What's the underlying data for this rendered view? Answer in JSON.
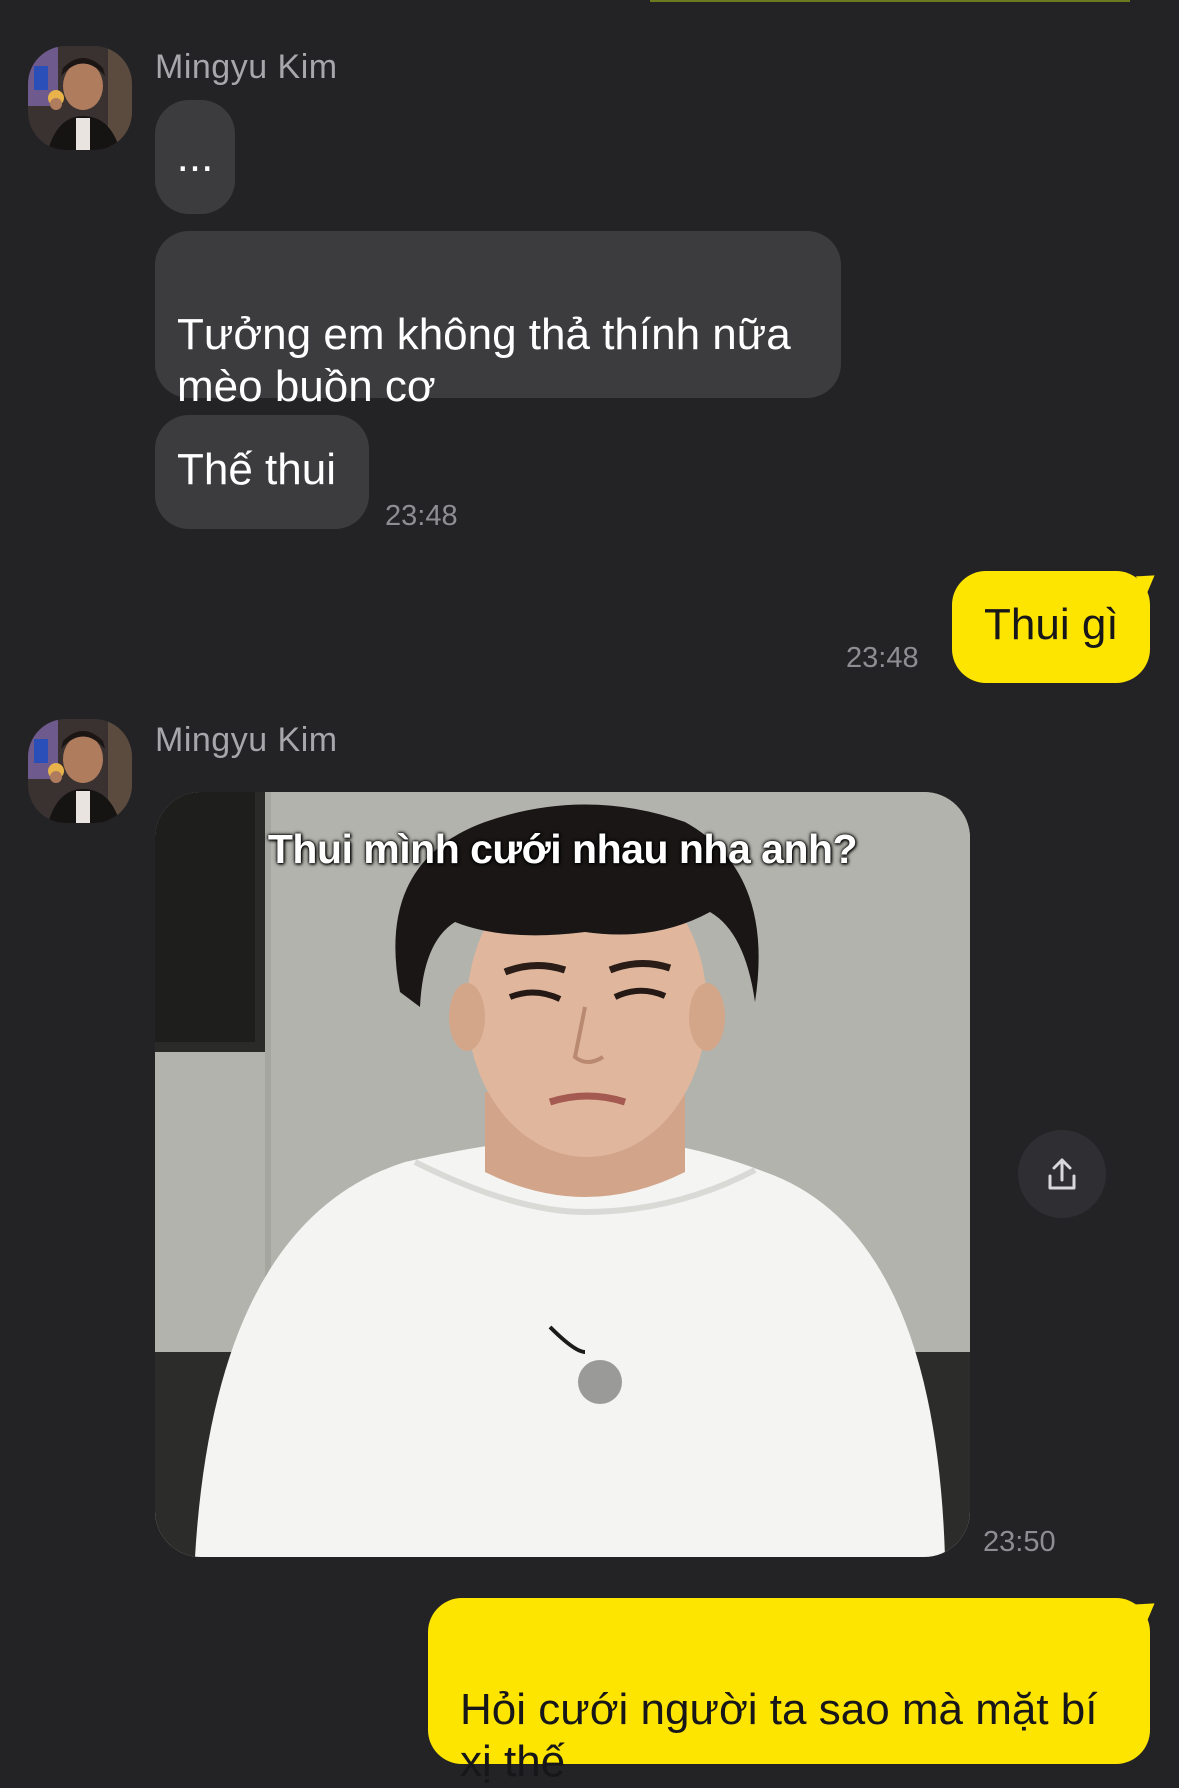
{
  "chat": {
    "accent": "#fee500",
    "background": "#232326",
    "incoming_bubble_color": "#3c3c3f",
    "sender_name": "Mingyu Kim",
    "groups": [
      {
        "sender": "Mingyu Kim",
        "messages": [
          "...",
          "Tưởng em không thả thính nữa\nmèo buồn cơ",
          "Thế thui"
        ],
        "time": "23:48"
      },
      {
        "outgoing": true,
        "messages": [
          "Thui gì"
        ],
        "time": "23:48"
      },
      {
        "sender": "Mingyu Kim",
        "image_caption": "Thui mình cưới nhau nha anh?",
        "time": "23:50",
        "share_icon": "share-icon"
      },
      {
        "outgoing": true,
        "messages": [
          "Hỏi cưới người ta sao mà mặt bí\nxị thế"
        ]
      }
    ]
  }
}
